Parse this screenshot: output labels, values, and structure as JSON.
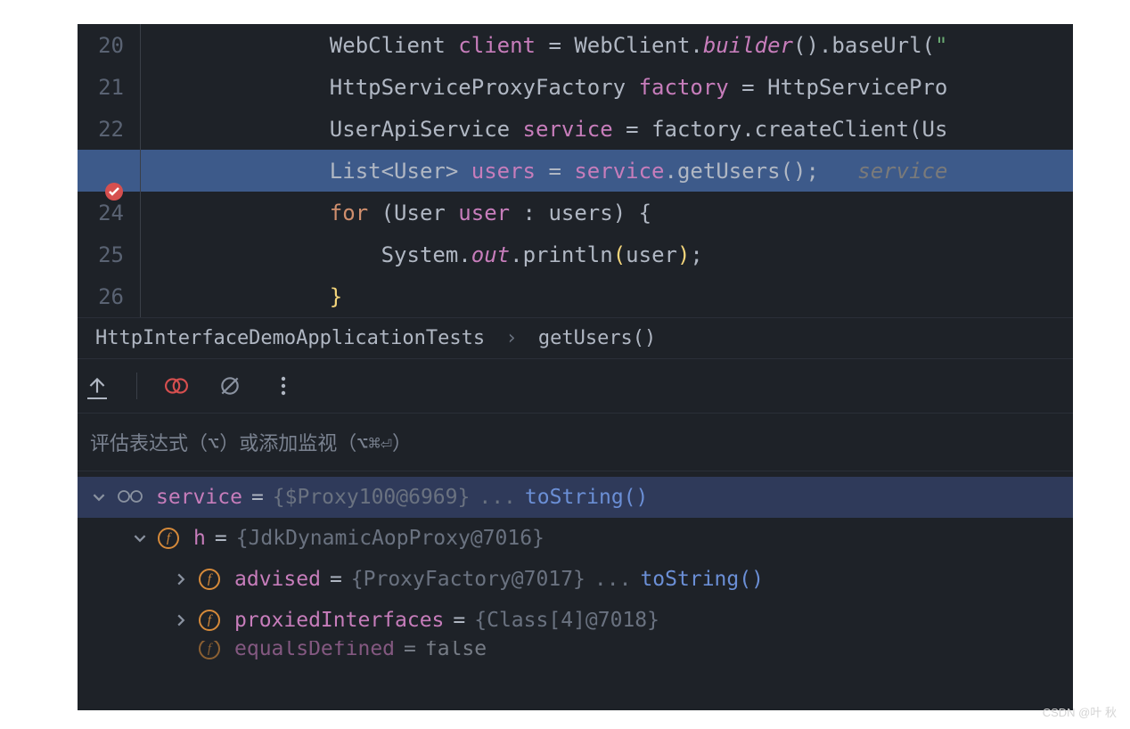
{
  "editor": {
    "lines": [
      {
        "num": "20",
        "indent": 2,
        "tokens": [
          {
            "t": "type",
            "v": "WebClient "
          },
          {
            "t": "var",
            "v": "client"
          },
          {
            "t": "punct",
            "v": " = "
          },
          {
            "t": "type",
            "v": "WebClient."
          },
          {
            "t": "italic",
            "v": "builder"
          },
          {
            "t": "punct",
            "v": "()."
          },
          {
            "t": "method",
            "v": "baseUrl"
          },
          {
            "t": "punct",
            "v": "("
          },
          {
            "t": "string",
            "v": "\""
          }
        ]
      },
      {
        "num": "21",
        "indent": 2,
        "tokens": [
          {
            "t": "type",
            "v": "HttpServiceProxyFactory "
          },
          {
            "t": "var",
            "v": "factory"
          },
          {
            "t": "punct",
            "v": " = "
          },
          {
            "t": "type",
            "v": "HttpServicePro"
          }
        ]
      },
      {
        "num": "22",
        "indent": 2,
        "tokens": [
          {
            "t": "type",
            "v": "UserApiService "
          },
          {
            "t": "var",
            "v": "service"
          },
          {
            "t": "punct",
            "v": " = "
          },
          {
            "t": "ident",
            "v": "factory."
          },
          {
            "t": "method",
            "v": "createClient"
          },
          {
            "t": "punct",
            "v": "("
          },
          {
            "t": "type",
            "v": "Us"
          }
        ]
      },
      {
        "num": "",
        "highlighted": true,
        "breakpoint": true,
        "indent": 2,
        "tokens": [
          {
            "t": "type",
            "v": "List<User> "
          },
          {
            "t": "var",
            "v": "users"
          },
          {
            "t": "punct",
            "v": " = "
          },
          {
            "t": "var",
            "v": "service"
          },
          {
            "t": "punct",
            "v": "."
          },
          {
            "t": "method",
            "v": "getUsers"
          },
          {
            "t": "punct",
            "v": "();   "
          },
          {
            "t": "comment",
            "v": "service"
          }
        ]
      },
      {
        "num": "24",
        "indent": 2,
        "tokens": [
          {
            "t": "kw",
            "v": "for "
          },
          {
            "t": "punct",
            "v": "("
          },
          {
            "t": "type",
            "v": "User "
          },
          {
            "t": "var",
            "v": "user"
          },
          {
            "t": "punct",
            "v": " : "
          },
          {
            "t": "ident",
            "v": "users) {"
          }
        ]
      },
      {
        "num": "25",
        "indent": 3,
        "tokens": [
          {
            "t": "type",
            "v": "System."
          },
          {
            "t": "field",
            "v": "out"
          },
          {
            "t": "punct",
            "v": "."
          },
          {
            "t": "method",
            "v": "println"
          },
          {
            "t": "paren",
            "v": "("
          },
          {
            "t": "ident",
            "v": "user"
          },
          {
            "t": "paren",
            "v": ")"
          },
          {
            "t": "punct",
            "v": ";"
          }
        ]
      },
      {
        "num": "26",
        "indent": 2,
        "tokens": [
          {
            "t": "paren",
            "v": "}"
          }
        ]
      }
    ]
  },
  "breadcrumb": {
    "class": "HttpInterfaceDemoApplicationTests",
    "method": "getUsers()"
  },
  "toolbar": {
    "icons": [
      "return-up-icon",
      "breakpoint-toggle-icon",
      "mute-breakpoints-icon",
      "more-icon"
    ]
  },
  "watch": {
    "placeholder": "评估表达式（⌥）或添加监视（⌥⌘⏎）"
  },
  "variables": [
    {
      "level": 0,
      "expanded": true,
      "selected": true,
      "icon": "glasses",
      "name": "service",
      "value": "{$Proxy100@6969}",
      "suffix_dots": "... ",
      "tostring": "toString()"
    },
    {
      "level": 1,
      "expanded": true,
      "icon": "f",
      "name": "h",
      "value": "{JdkDynamicAopProxy@7016}"
    },
    {
      "level": 2,
      "expanded": false,
      "icon": "f",
      "name": "advised",
      "value": "{ProxyFactory@7017}",
      "suffix_dots": "... ",
      "tostring": "toString()"
    },
    {
      "level": 2,
      "expanded": false,
      "icon": "f",
      "name": "proxiedInterfaces",
      "value": "{Class[4]@7018}"
    },
    {
      "level": 2,
      "icon": "f",
      "name": "equalsDefined",
      "bool": "false",
      "partial": true
    }
  ],
  "watermark": "CSDN @叶 秋"
}
